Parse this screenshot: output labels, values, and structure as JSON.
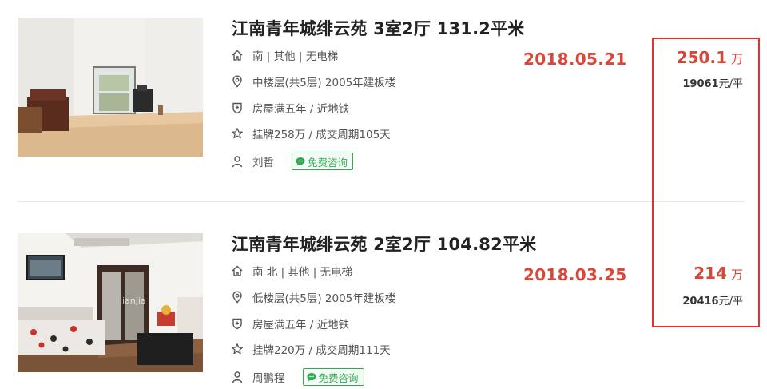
{
  "listings": [
    {
      "title": "江南青年城绯云苑 3室2厅 131.2平米",
      "orientation": "南 | 其他 | 无电梯",
      "floor": "中楼层(共5层) 2005年建板楼",
      "tags": "房屋满五年 / 近地铁",
      "listing_info": "挂牌258万 / 成交周期105天",
      "agent": "刘哲",
      "consult_label": "免费咨询",
      "date": "2018.05.21",
      "total_price": "250.1",
      "price_unit": "万",
      "unit_price": "19061",
      "unit_price_suffix": "元/平"
    },
    {
      "title": "江南青年城绯云苑 2室2厅 104.82平米",
      "orientation": "南 北 | 其他 | 无电梯",
      "floor": "低楼层(共5层) 2005年建板楼",
      "tags": "房屋满五年 / 近地铁",
      "listing_info": "挂牌220万 / 成交周期111天",
      "agent": "周鹏程",
      "consult_label": "免费咨询",
      "date": "2018.03.25",
      "total_price": "214",
      "price_unit": "万",
      "unit_price": "20416",
      "unit_price_suffix": "元/平"
    }
  ],
  "watermark": "lianjia",
  "colors": {
    "accent_red": "#d9473b",
    "highlight_box": "#e0322b",
    "consult_green": "#2fab52"
  },
  "icons": [
    "home-icon",
    "location-pin-icon",
    "shield-icon",
    "star-icon",
    "person-icon",
    "chat-bubble-icon"
  ]
}
